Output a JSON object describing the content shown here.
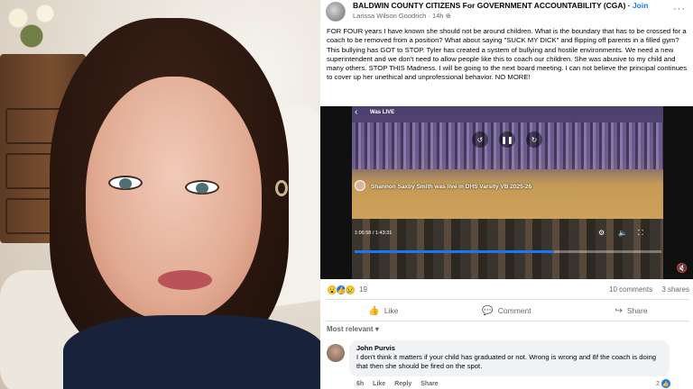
{
  "group": {
    "name": "BALDWIN COUNTY CITIZENS For GOVERNMENT ACCOUNTABILITY (CGA)",
    "join_label": "Join",
    "author": "Larissa Wilson Goodrich",
    "time": "14h",
    "more_icon": "more-horizontal-icon"
  },
  "post": {
    "text": "FOR FOUR years I have known she should not be around children.  What is the boundary that has to be crossed for a coach to be removed from a position?  What about saying \"SUCK MY DICK\" and flipping off parents in a filled gym?  This bullying has GOT to STOP.  Tyler has created a system of bullying and hostile environments.  We need a new superintendent and we don't need to allow people like this to coach our children.  She was abusive to my child and many others.  STOP THIS Madness.  I will be going to the next board meeting.  I can not believe the principal continues to cover up her unethical and unprofessional behavior.  NO MORE!"
  },
  "video": {
    "was_live": "Was LIVE",
    "caption": "Shannon Saxby Smith was live in DHS Varsity VB 2025-26",
    "time": "1:06:58 / 1:43:31",
    "progress": 0.65
  },
  "reactions": {
    "count": "19",
    "comments": "10 comments",
    "shares": "3 shares"
  },
  "actions": {
    "like": "Like",
    "comment": "Comment",
    "share": "Share"
  },
  "sort": {
    "label": "Most relevant"
  },
  "comment": {
    "author": "John Purvis",
    "text": "I don't think it matters if your child has graduated or not. Wrong is wrong and 8f the coach is doing that then she should be fired on the spot.",
    "time": "6h",
    "like": "Like",
    "reply": "Reply",
    "share": "Share",
    "like_count": "2"
  },
  "colors": {
    "accent": "#1877f2",
    "secondary_text": "#65676b"
  }
}
